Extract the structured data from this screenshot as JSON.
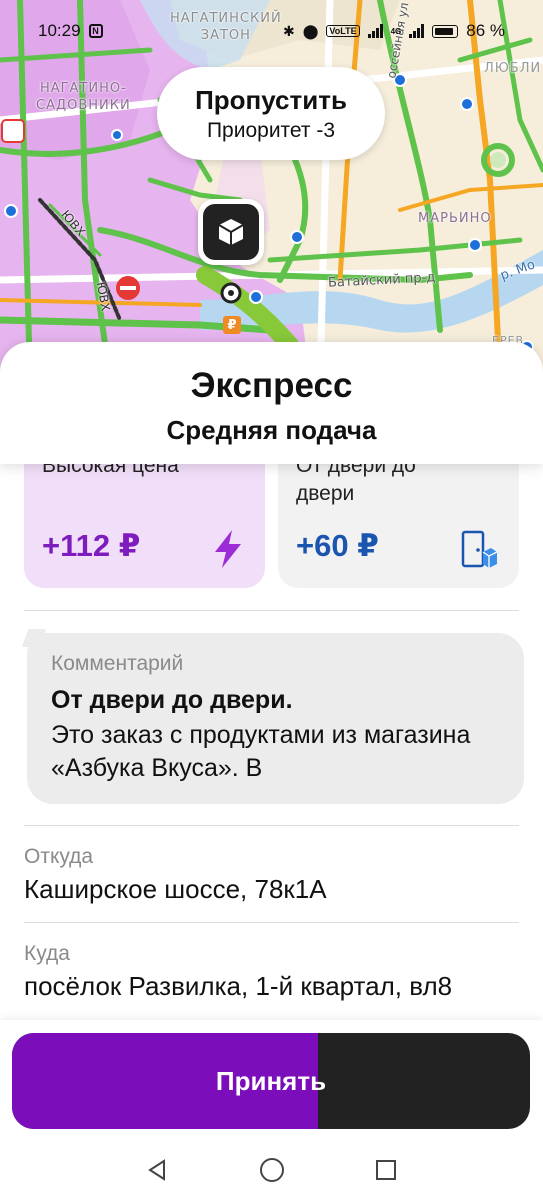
{
  "status_bar": {
    "time": "10:29",
    "network_badge": "VoLTE",
    "signal_type": "4G",
    "battery": "86 %"
  },
  "map": {
    "labels": {
      "nagatinsky_zaton": "НАГАТИНСКИЙ\nЗАТОН",
      "nagatino_sadovniki": "НАГАТИНО-\nСАДОВНИКИ",
      "lyublino": "ЛЮБЛИ",
      "marino": "МАРЬИНО",
      "bataysky": "Батайский пр-д",
      "river": "р. Мо",
      "yuvkh_1": "ЮВХ",
      "yuvkh_2": "ЮВХ",
      "street_top": "оссейная ул",
      "corner": "ЕРЕВ"
    },
    "priority": {
      "title": "Пропустить",
      "subtitle": "Приоритет -3"
    },
    "ruble_badge": "₽"
  },
  "order": {
    "tariff": "Экспресс",
    "pickup_time": "Средняя подача",
    "cards": [
      {
        "label": "Высокая цена",
        "value": "+112 ₽",
        "icon": "lightning-icon"
      },
      {
        "label": "От двери до двери",
        "value": "+60 ₽",
        "icon": "door-box-icon"
      }
    ],
    "comment": {
      "label": "Комментарий",
      "title": "От двери до двери.",
      "text": "Это заказ с продуктами из магазина «Азбука Вкуса». В"
    },
    "from": {
      "label": "Откуда",
      "value": "Каширское шоссе, 78к1А"
    },
    "to": {
      "label": "Куда",
      "value": "посёлок Развилка, 1-й квартал, вл8"
    }
  },
  "accept_button": {
    "label": "Принять",
    "progress_percent": 59
  },
  "nav": {
    "back": "back-triangle-icon",
    "home": "home-circle-icon",
    "recent": "recent-square-icon"
  },
  "colors": {
    "accent": "#7b0dba",
    "price_bg": "#f1def8",
    "price_text": "#7e1cbe",
    "door_text": "#1a55b0",
    "traffic_green": "#5ec24b",
    "traffic_orange": "#f5a623"
  }
}
